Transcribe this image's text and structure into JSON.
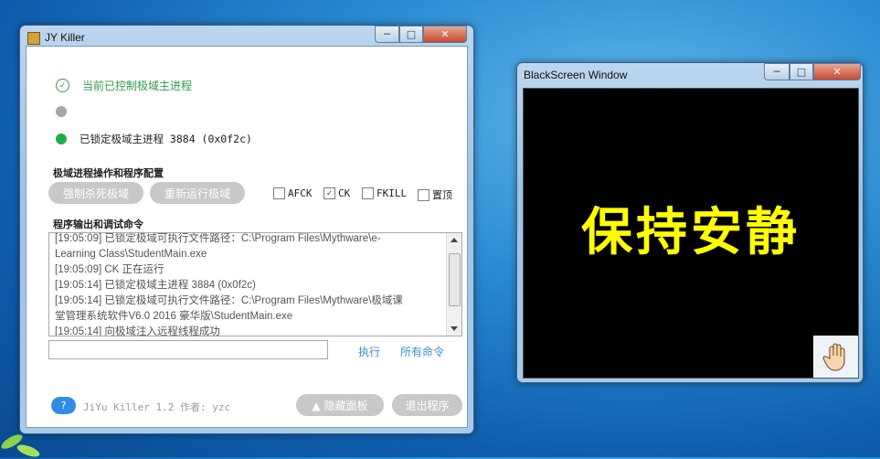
{
  "jy_window": {
    "title": "JY Killer",
    "status": [
      {
        "text": "当前已控制极域主进程",
        "color": "#2e9b4a"
      },
      {
        "text": "",
        "color": "#a6a6a6"
      },
      {
        "text": "已锁定极域主进程 3884 (0x0f2c)",
        "color": "#1fae4a"
      }
    ],
    "section_ops": "极域进程操作和程序配置",
    "btn_kill": "强制杀死极域",
    "btn_restart": "重新运行极域",
    "options": [
      {
        "label": "AFCK",
        "checked": false
      },
      {
        "label": "CK",
        "checked": true
      },
      {
        "label": "FKILL",
        "checked": false
      },
      {
        "label": "置顶",
        "checked": false
      }
    ],
    "section_log": "程序输出和调试命令",
    "log_lines": [
      "[19:05:09] 已锁定极域可执行文件路径：C:\\Program Files\\Mythware\\e-",
      "Learning Class\\StudentMain.exe",
      "[19:05:09] CK 正在运行",
      "[19:05:14] 已锁定极域主进程 3884 (0x0f2c)",
      "[19:05:14] 已锁定极域可执行文件路径：C:\\Program Files\\Mythware\\极域课",
      "堂管理系统软件V6.0 2016 豪华版\\StudentMain.exe",
      "[19:05:14] 向极域注入远程线程成功"
    ],
    "command_value": "",
    "execute_label": "执行",
    "all_commands_label": "所有命令",
    "help_label": "?",
    "version_text": "JiYu Killer 1.2 作者: yzc",
    "hide_panel_label": "▲ 隐藏面板",
    "exit_label": "退出程序"
  },
  "black_window": {
    "title": "BlackScreen Window",
    "message": "保持安静",
    "message_color": "#ffff00",
    "hand_icon": "hand-icon"
  },
  "window_controls": {
    "minimize": "─",
    "maximize": "□",
    "close": "✕"
  }
}
